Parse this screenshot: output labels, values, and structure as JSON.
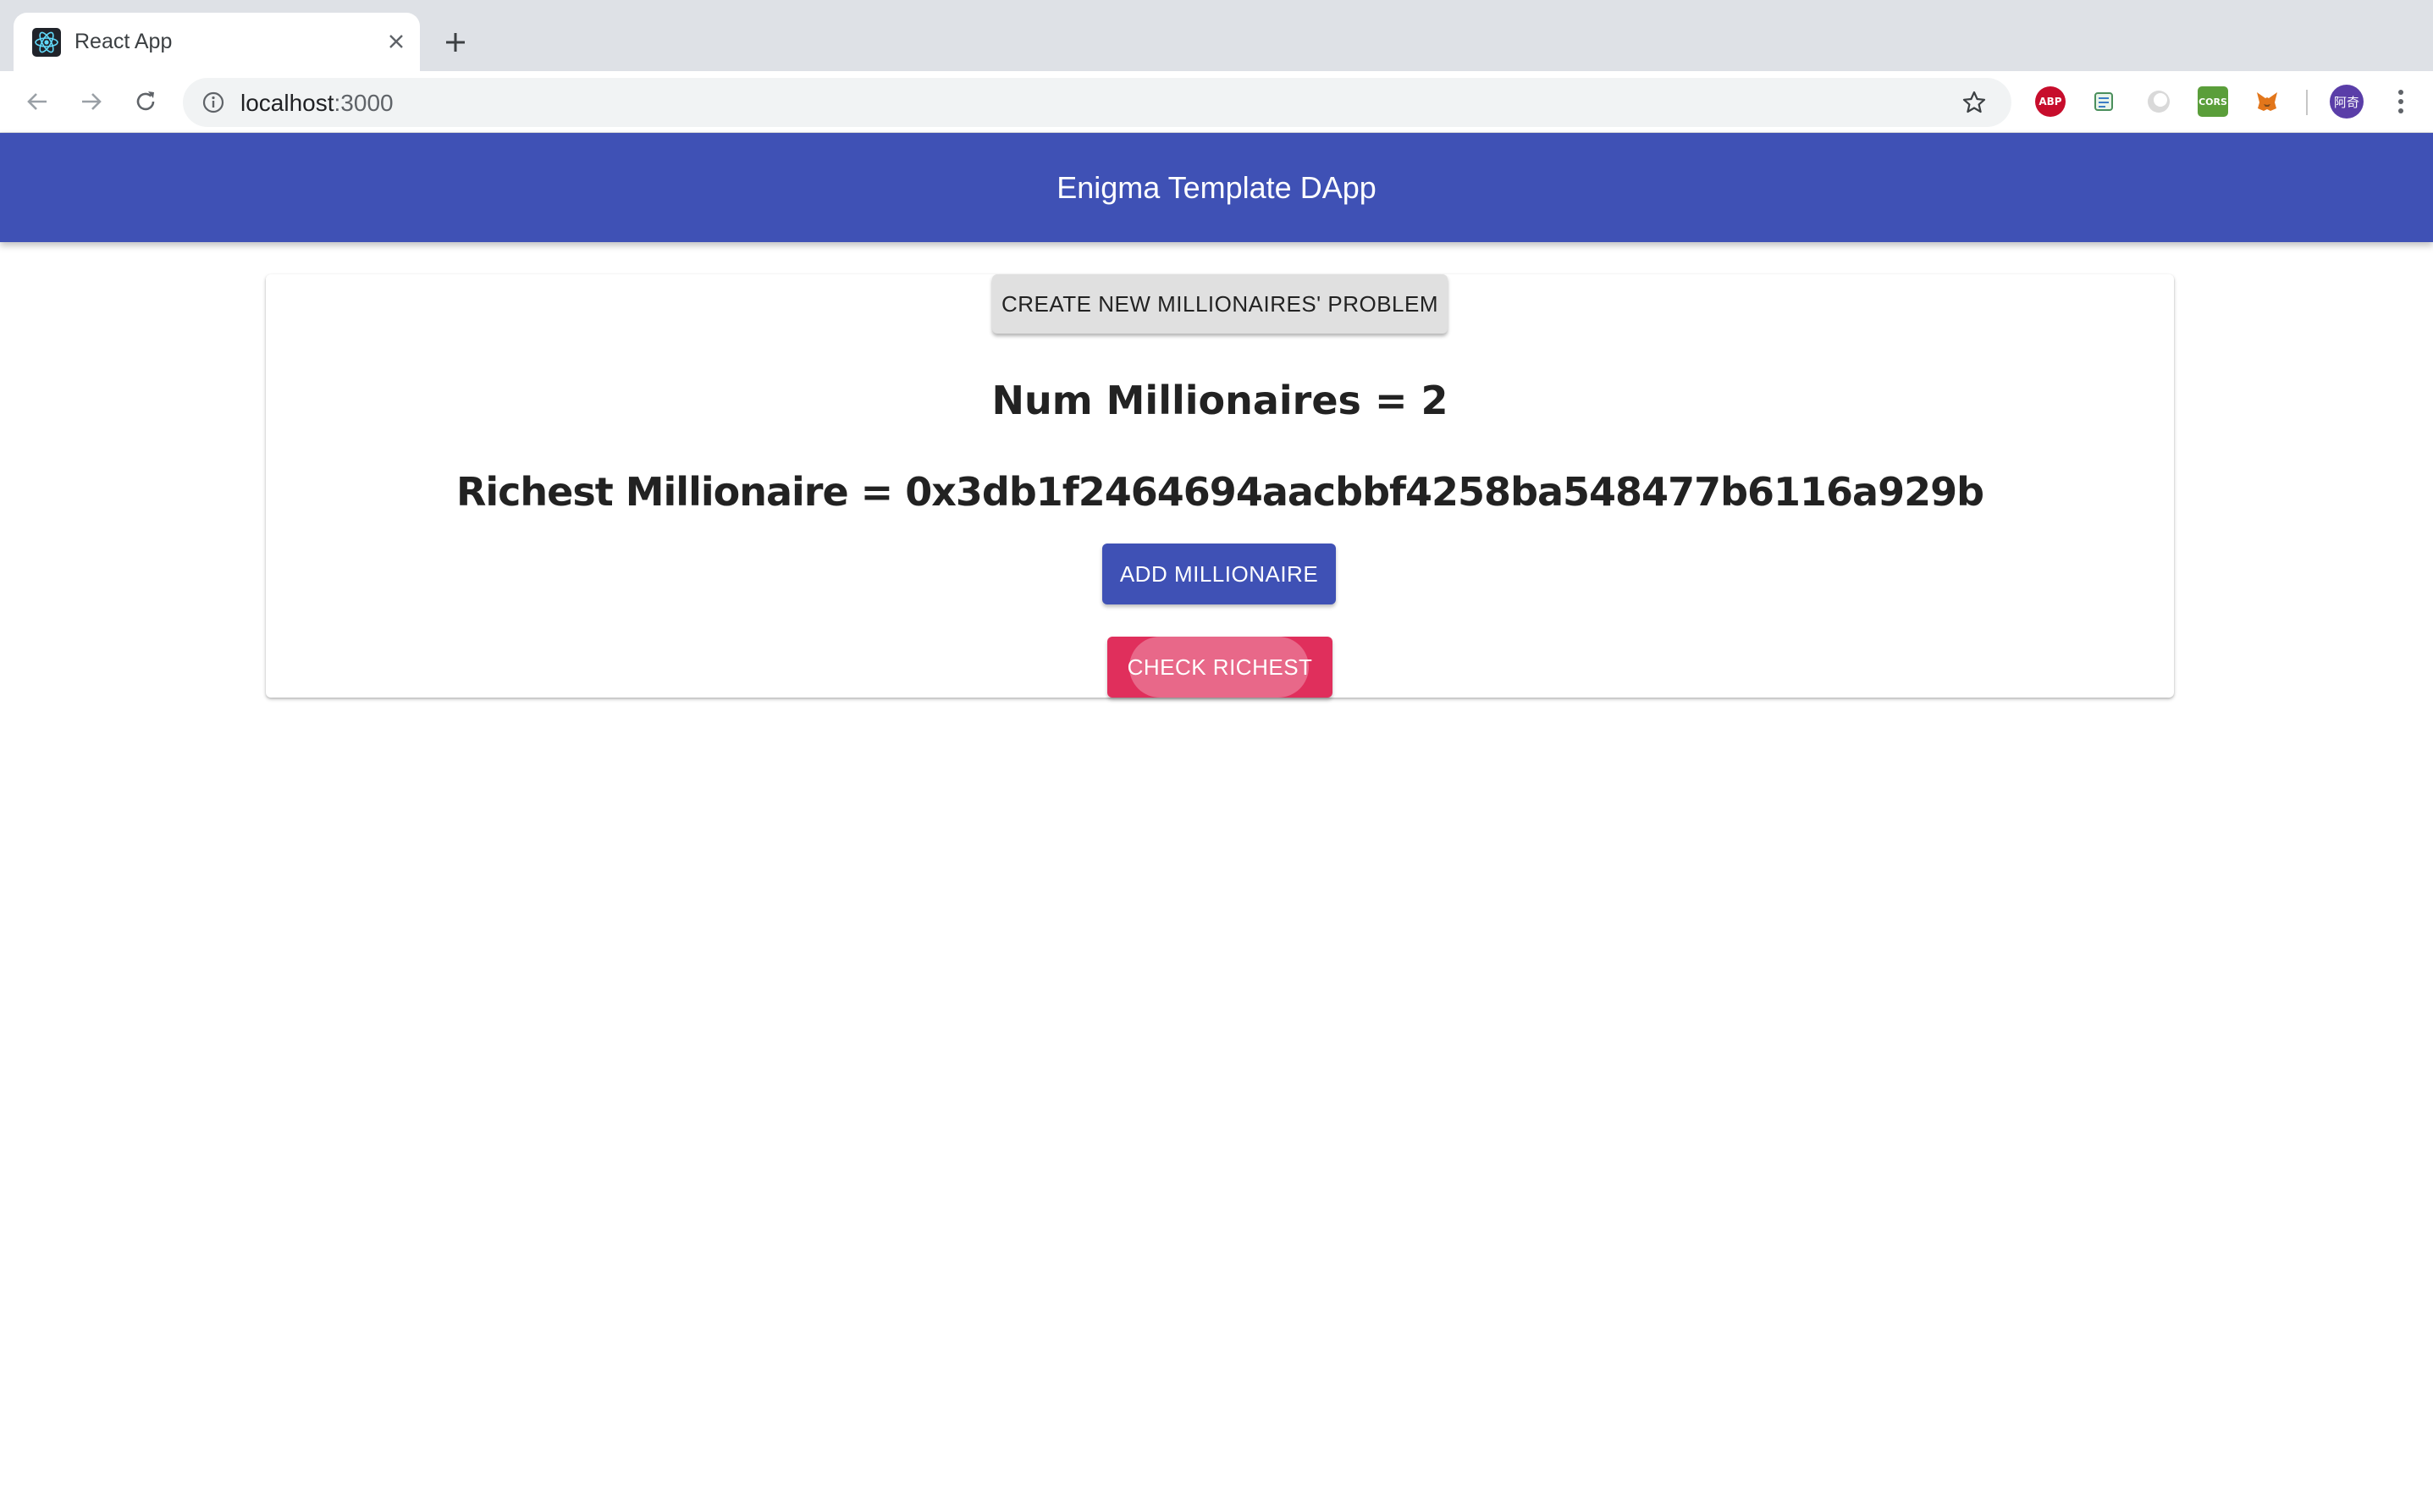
{
  "browser": {
    "tab_title": "React App",
    "url_host": "localhost",
    "url_port": ":3000",
    "extensions": {
      "abp_label": "ABP",
      "cors_label": "CORS",
      "profile_label": "阿奇"
    }
  },
  "app": {
    "title": "Enigma Template DApp",
    "create_button_label": "CREATE NEW MILLIONAIRES' PROBLEM",
    "num_millionaires_text": "Num Millionaires = 2",
    "richest_text": "Richest Millionaire = 0x3db1f2464694aacbbf4258ba548477b6116a929b",
    "add_button_label": "ADD MILLIONAIRE",
    "check_button_label": "CHECK RICHEST"
  },
  "colors": {
    "appbar": "#3f51b5",
    "primary_button": "#3f51b5",
    "secondary_button": "#e02f5c",
    "default_button": "#e0e0e0"
  },
  "icons": [
    "react-favicon-icon",
    "close-icon",
    "plus-icon",
    "back-arrow-icon",
    "forward-arrow-icon",
    "reload-icon",
    "info-icon",
    "star-icon",
    "adblock-plus-icon",
    "script-extension-icon",
    "circle-extension-icon",
    "cors-extension-icon",
    "metamask-fox-icon",
    "profile-avatar",
    "more-vert-icon"
  ]
}
